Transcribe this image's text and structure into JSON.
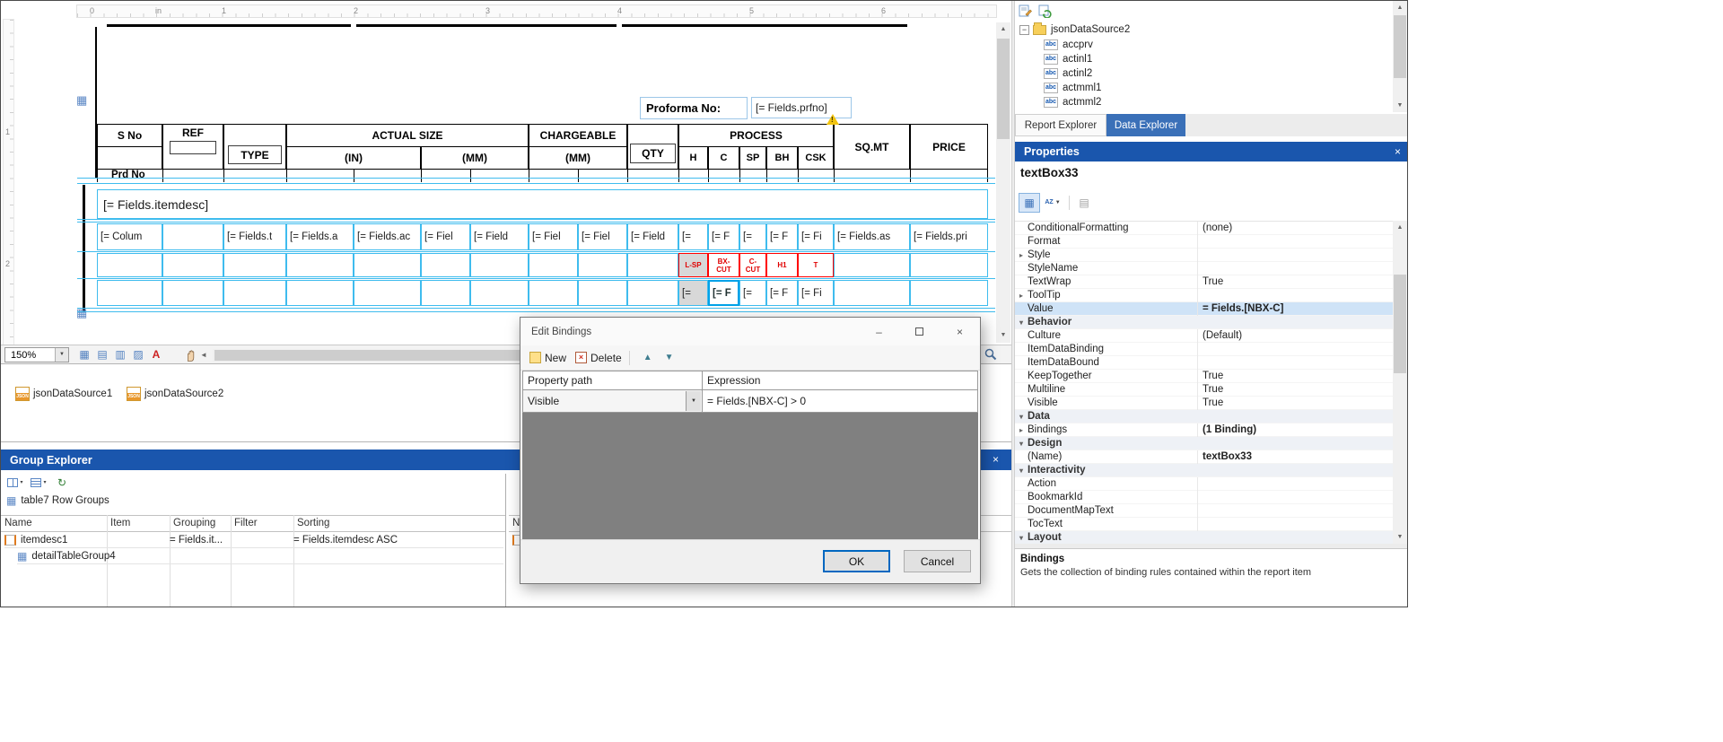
{
  "canvas": {
    "ruler_labels": [
      "0",
      "in",
      "1",
      "2",
      "3",
      "4",
      "5",
      "6"
    ],
    "vruler_labels": [
      "1",
      "2"
    ],
    "proforma_label": "Proforma No:",
    "proforma_value": "[= Fields.prfno]",
    "header": {
      "s_no": "S No",
      "ref": "REF",
      "type": "TYPE",
      "actual_size": "ACTUAL SIZE",
      "in": "(IN)",
      "mm": "(MM)",
      "chargeable": "CHARGEABLE",
      "chargeable_mm": "(MM)",
      "qty": "QTY",
      "process": "PROCESS",
      "process_cols": [
        "H",
        "C",
        "SP",
        "BH",
        "CSK"
      ],
      "sq_mt": "SQ.MT",
      "price": "PRICE",
      "prd_no": "Prd No"
    },
    "itemdesc": "[= Fields.itemdesc]",
    "detail_cells": [
      "[= Colum",
      "",
      "[= Fields.t",
      "[= Fields.a",
      "[= Fields.ac",
      "[= Fiel",
      "[= Field",
      "[= Fiel",
      "[= Fiel",
      "[= Field",
      "[=",
      "[= F",
      "[=",
      "[= F",
      "[= Fi",
      "[= Fields.as",
      "[= Fields.pri"
    ],
    "process_cells": [
      "L-SP",
      "BX-CUT",
      "C-CUT",
      "H1",
      "T"
    ],
    "bottom_cells": [
      "[=",
      "[= F",
      "[=",
      "[= F",
      "[= Fi"
    ],
    "zoom_level": "150%"
  },
  "datasources": {
    "icon_label": "JSON",
    "items": [
      "jsonDataSource1",
      "jsonDataSource2"
    ]
  },
  "group_explorer": {
    "title": "Group Explorer",
    "row_groups_label": "table7 Row Groups",
    "columns": [
      "Name",
      "Item",
      "Grouping",
      "Filter",
      "Sorting"
    ],
    "rows": [
      {
        "name": "itemdesc1",
        "item": "",
        "grouping": "= Fields.it...",
        "filter": "",
        "sorting": "= Fields.itemdesc ASC"
      },
      {
        "name": "detailTableGroup4",
        "item": "",
        "grouping": "",
        "filter": "",
        "sorting": ""
      }
    ],
    "right_panel_first_column": "Name"
  },
  "dialog": {
    "title": "Edit Bindings",
    "new_label": "New",
    "delete_label": "Delete",
    "columns": [
      "Property path",
      "Expression"
    ],
    "binding_row": {
      "property": "Visible",
      "expression": "= Fields.[NBX-C] > 0"
    },
    "ok_label": "OK",
    "cancel_label": "Cancel"
  },
  "data_explorer": {
    "root": "jsonDataSource2",
    "field_icon_label": "abc",
    "fields": [
      "accprv",
      "actinl1",
      "actinl2",
      "actmml1",
      "actmml2"
    ],
    "tabs": [
      "Report Explorer",
      "Data Explorer"
    ],
    "active_tab": "Data Explorer"
  },
  "properties_panel": {
    "title": "Properties",
    "object_name": "textBox33",
    "rows": [
      {
        "name": "ConditionalFormatting",
        "value": "(none)"
      },
      {
        "name": "Format",
        "value": ""
      },
      {
        "name": "Style",
        "value": "",
        "arrow": "right"
      },
      {
        "name": "StyleName",
        "value": ""
      },
      {
        "name": "TextWrap",
        "value": "True"
      },
      {
        "name": "ToolTip",
        "value": "",
        "arrow": "right"
      },
      {
        "name": "Value",
        "value": "= Fields.[NBX-C]",
        "selected": true,
        "bold": true
      },
      {
        "name": "Behavior",
        "type": "category",
        "arrow": "down"
      },
      {
        "name": "Culture",
        "value": "(Default)"
      },
      {
        "name": "ItemDataBinding",
        "value": ""
      },
      {
        "name": "ItemDataBound",
        "value": ""
      },
      {
        "name": "KeepTogether",
        "value": "True"
      },
      {
        "name": "Multiline",
        "value": "True"
      },
      {
        "name": "Visible",
        "value": "True"
      },
      {
        "name": "Data",
        "type": "category",
        "arrow": "down"
      },
      {
        "name": "Bindings",
        "value": "(1 Binding)",
        "arrow": "right",
        "bold": true
      },
      {
        "name": "Design",
        "type": "category",
        "arrow": "down"
      },
      {
        "name": "(Name)",
        "value": "textBox33",
        "bold": true
      },
      {
        "name": "Interactivity",
        "type": "category",
        "arrow": "down"
      },
      {
        "name": "Action",
        "value": ""
      },
      {
        "name": "BookmarkId",
        "value": ""
      },
      {
        "name": "DocumentMapText",
        "value": ""
      },
      {
        "name": "TocText",
        "value": ""
      },
      {
        "name": "Layout",
        "type": "category",
        "arrow": "down"
      }
    ],
    "description_title": "Bindings",
    "description_text": "Gets the collection of binding rules contained within the report item"
  },
  "icons": {
    "close": "×",
    "minimize": "–",
    "dropdown": "▼",
    "up_arrow": "▲",
    "down_arrow": "▼",
    "scroll_left": "◄",
    "scroll_right": "►",
    "scroll_up": "▲",
    "scroll_down": "▼",
    "expander_open": "▾",
    "expander_closed": "▸",
    "tree_collapse": "−",
    "refresh": "↻",
    "grid": "▦",
    "grid2": "▤",
    "grid3": "▥",
    "grid4": "▨",
    "letter_a": "A",
    "az": "AZ",
    "warning": "!"
  },
  "colors": {
    "titlebar_blue": "#1a56ad",
    "active_tab_blue": "#3a70b8",
    "adorner_cyan": "#3fbcee",
    "selection_cyan": "#00a2e8",
    "cell_red": "#ff0000",
    "selected_row_bg": "#cfe3f7"
  }
}
